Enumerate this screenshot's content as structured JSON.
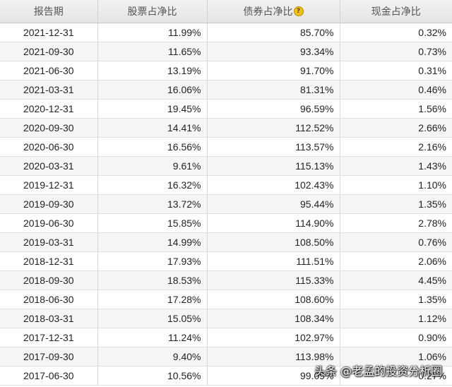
{
  "table": {
    "headers": {
      "date": "报告期",
      "stock": "股票占净比",
      "bond": "债券占净比",
      "cash": "现金占净比"
    },
    "rows": [
      {
        "date": "2021-12-31",
        "stock": "11.99%",
        "bond": "85.70%",
        "cash": "0.32%"
      },
      {
        "date": "2021-09-30",
        "stock": "11.65%",
        "bond": "93.34%",
        "cash": "0.73%"
      },
      {
        "date": "2021-06-30",
        "stock": "13.19%",
        "bond": "91.70%",
        "cash": "0.31%"
      },
      {
        "date": "2021-03-31",
        "stock": "16.06%",
        "bond": "81.31%",
        "cash": "0.46%"
      },
      {
        "date": "2020-12-31",
        "stock": "19.45%",
        "bond": "96.59%",
        "cash": "1.56%"
      },
      {
        "date": "2020-09-30",
        "stock": "14.41%",
        "bond": "112.52%",
        "cash": "2.66%"
      },
      {
        "date": "2020-06-30",
        "stock": "16.56%",
        "bond": "113.57%",
        "cash": "2.16%"
      },
      {
        "date": "2020-03-31",
        "stock": "9.61%",
        "bond": "115.13%",
        "cash": "1.43%"
      },
      {
        "date": "2019-12-31",
        "stock": "16.32%",
        "bond": "102.43%",
        "cash": "1.10%"
      },
      {
        "date": "2019-09-30",
        "stock": "13.72%",
        "bond": "95.44%",
        "cash": "1.35%"
      },
      {
        "date": "2019-06-30",
        "stock": "15.85%",
        "bond": "114.90%",
        "cash": "2.78%"
      },
      {
        "date": "2019-03-31",
        "stock": "14.99%",
        "bond": "108.50%",
        "cash": "0.76%"
      },
      {
        "date": "2018-12-31",
        "stock": "17.93%",
        "bond": "111.51%",
        "cash": "2.06%"
      },
      {
        "date": "2018-09-30",
        "stock": "18.53%",
        "bond": "115.33%",
        "cash": "4.45%"
      },
      {
        "date": "2018-06-30",
        "stock": "17.28%",
        "bond": "108.60%",
        "cash": "1.35%"
      },
      {
        "date": "2018-03-31",
        "stock": "15.05%",
        "bond": "108.34%",
        "cash": "1.12%"
      },
      {
        "date": "2017-12-31",
        "stock": "11.24%",
        "bond": "102.97%",
        "cash": "0.90%"
      },
      {
        "date": "2017-09-30",
        "stock": "9.40%",
        "bond": "113.98%",
        "cash": "1.06%"
      },
      {
        "date": "2017-06-30",
        "stock": "10.56%",
        "bond": "99.09%",
        "cash": "0.27%"
      }
    ]
  },
  "help_icon": {
    "glyph": "?",
    "icon": "question-icon",
    "color": "#f0c020"
  },
  "watermark": {
    "text": "头条 @老孟的投资分析圈"
  }
}
